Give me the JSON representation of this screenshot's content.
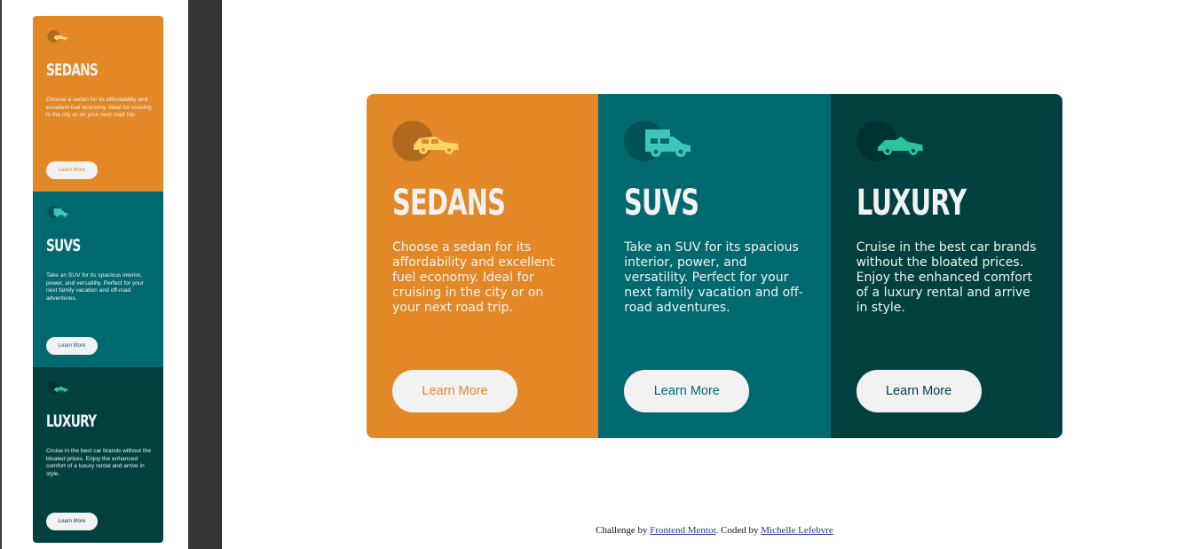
{
  "colors": {
    "bright_orange": "#e38826",
    "dark_cyan": "#006970",
    "very_dark_cyan": "#004140",
    "very_light_gray": "#f2f2f2"
  },
  "cards": [
    {
      "title": "SEDANS",
      "description": "Choose a sedan for its affordability and excellent fuel economy. Ideal for cruising in the city or on your next road trip.",
      "button_label": "Learn More",
      "icon": "sedan-car-icon"
    },
    {
      "title": "SUVS",
      "description": "Take an SUV for its spacious interior, power, and versatility. Perfect for your next family vacation and off-road adventures.",
      "button_label": "Learn More",
      "icon": "suv-car-icon"
    },
    {
      "title": "LUXURY",
      "description": "Cruise in the best car brands without the bloated prices. Enjoy the enhanced comfort of a luxury rental and arrive in style.",
      "button_label": "Learn More",
      "icon": "luxury-car-icon"
    }
  ],
  "footer": {
    "prefix": "Challenge by ",
    "link1": "Frontend Mentor",
    "middle": ". Coded by ",
    "link2": "Michelle Lefebvre"
  }
}
